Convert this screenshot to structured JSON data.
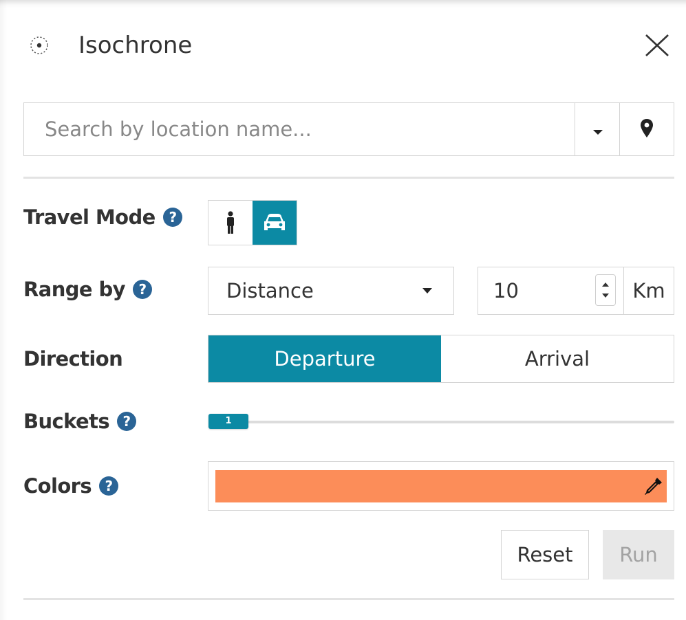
{
  "header": {
    "title": "Isochrone",
    "icon": "isochrone-icon",
    "close_icon": "close-icon"
  },
  "search": {
    "value": "",
    "placeholder": "Search by location name...",
    "dropdown_icon": "caret-down-icon",
    "pin_icon": "map-pin-icon"
  },
  "travel_mode": {
    "label": "Travel Mode",
    "options": [
      {
        "name": "walk",
        "icon": "person-icon",
        "selected": false
      },
      {
        "name": "drive",
        "icon": "car-icon",
        "selected": true
      }
    ]
  },
  "range_by": {
    "label": "Range by",
    "selected": "Distance",
    "value": "10",
    "unit": "Km"
  },
  "direction": {
    "label": "Direction",
    "options": [
      {
        "label": "Departure",
        "selected": true
      },
      {
        "label": "Arrival",
        "selected": false
      }
    ]
  },
  "buckets": {
    "label": "Buckets",
    "value": "1"
  },
  "colors": {
    "label": "Colors",
    "swatch": "#fc8d59",
    "picker_icon": "eyedropper-icon"
  },
  "actions": {
    "reset_label": "Reset",
    "run_label": "Run"
  },
  "theme": {
    "accent": "#0c8aa4",
    "help_icon_color": "#2a6496",
    "text": "#333333"
  }
}
